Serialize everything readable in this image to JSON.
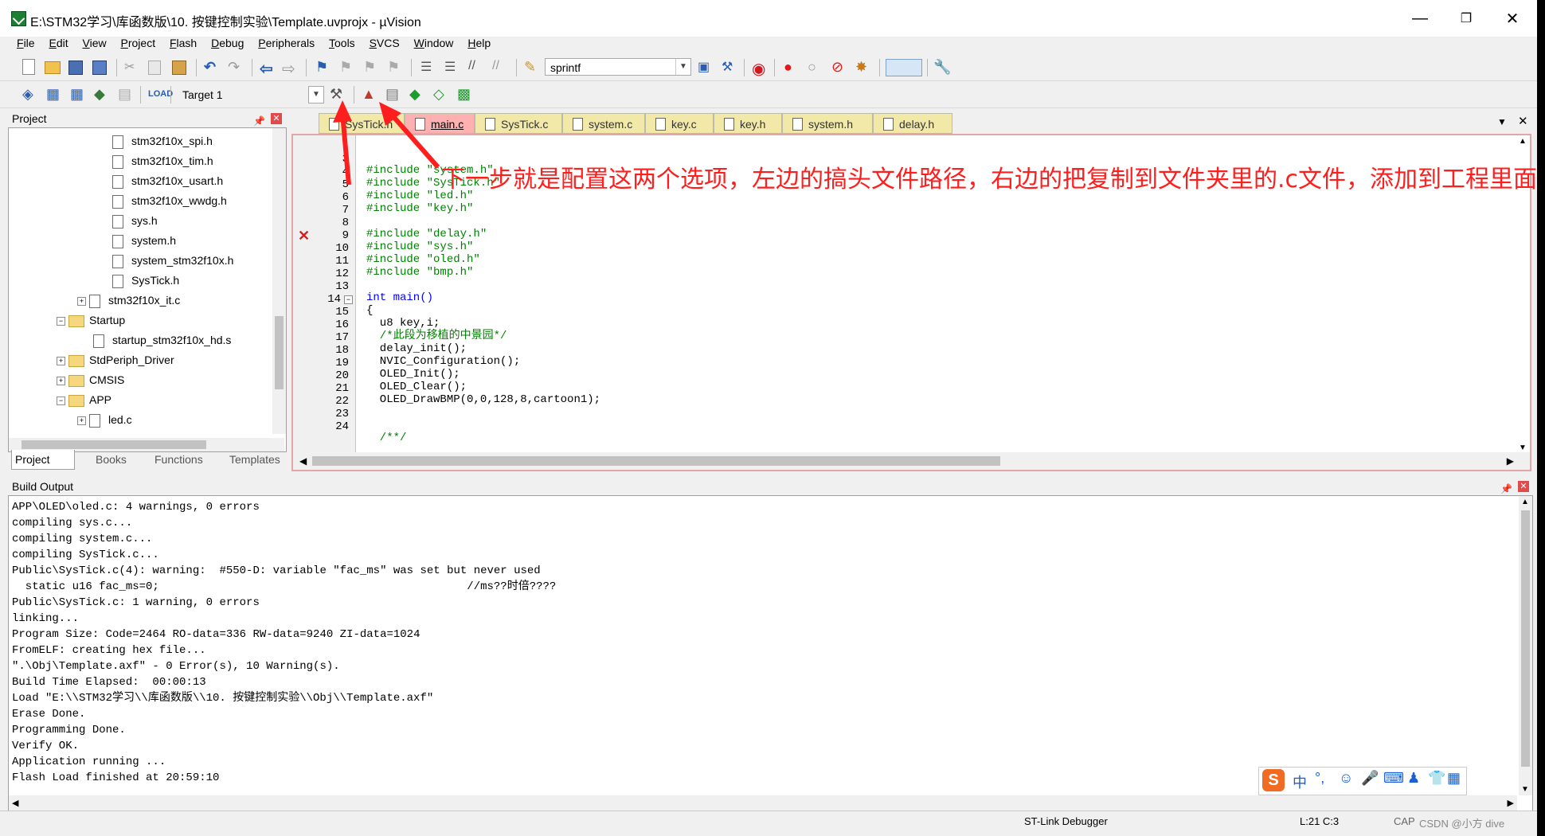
{
  "window": {
    "title": "E:\\STM32学习\\库函数版\\10. 按键控制实验\\Template.uvprojx - µVision",
    "min": "—",
    "max": "❐",
    "close": "✕"
  },
  "menu": [
    "File",
    "Edit",
    "View",
    "Project",
    "Flash",
    "Debug",
    "Peripherals",
    "Tools",
    "SVCS",
    "Window",
    "Help"
  ],
  "toolbar": {
    "find_text": "sprintf",
    "target": "Target 1"
  },
  "project_panel": {
    "title": "Project",
    "items": [
      {
        "label": "stm32f10x_spi.h"
      },
      {
        "label": "stm32f10x_tim.h"
      },
      {
        "label": "stm32f10x_usart.h"
      },
      {
        "label": "stm32f10x_wwdg.h"
      },
      {
        "label": "sys.h"
      },
      {
        "label": "system.h"
      },
      {
        "label": "system_stm32f10x.h"
      },
      {
        "label": "SysTick.h"
      },
      {
        "label": "stm32f10x_it.c"
      },
      {
        "label": "Startup"
      },
      {
        "label": "startup_stm32f10x_hd.s"
      },
      {
        "label": "StdPeriph_Driver"
      },
      {
        "label": "CMSIS"
      },
      {
        "label": "APP"
      },
      {
        "label": "led.c"
      }
    ],
    "tabs": [
      "Project",
      "Books",
      "Functions",
      "Templates"
    ]
  },
  "editor": {
    "tabs": [
      "SysTick.h",
      "main.c",
      "SysTick.c",
      "system.c",
      "key.c",
      "key.h",
      "system.h",
      "delay.h"
    ],
    "active_tab": "main.c",
    "line_numbers": [
      "3",
      "4",
      "5",
      "6",
      "7",
      "8",
      "9",
      "10",
      "11",
      "12",
      "13",
      "14",
      "15",
      "16",
      "17",
      "18",
      "19",
      "20",
      "21",
      "22",
      "23",
      "24"
    ],
    "lines": [
      "#include \"system.h\"",
      "#include \"SysTick.h\"",
      "#include \"led.h\"",
      "#include \"key.h\"",
      "",
      "#include \"delay.h\"",
      "#include \"sys.h\"",
      "#include \"oled.h\"",
      "#include \"bmp.h\"",
      "",
      "int main()",
      "{",
      "  u8 key,i;",
      "  /*此段为移植的中景园*/",
      "  delay_init();",
      "  NVIC_Configuration();",
      "  OLED_Init();",
      "  OLED_Clear();",
      "  OLED_DrawBMP(0,0,128,8,cartoon1);",
      "",
      "",
      "  /**/"
    ],
    "annotation": "下一步就是配置这两个选项，左边的搞头文件路径，右边的把复制到文件夹里的.c文件，添加到工程里面"
  },
  "build_output": {
    "title": "Build Output",
    "lines": [
      "APP\\OLED\\oled.c: 4 warnings, 0 errors",
      "compiling sys.c...",
      "compiling system.c...",
      "compiling SysTick.c...",
      "Public\\SysTick.c(4): warning:  #550-D: variable \"fac_ms\" was set but never used",
      "  static u16 fac_ms=0;                                              //ms??时倍????",
      "Public\\SysTick.c: 1 warning, 0 errors",
      "linking...",
      "Program Size: Code=2464 RO-data=336 RW-data=9240 ZI-data=1024",
      "FromELF: creating hex file...",
      "\".\\Obj\\Template.axf\" - 0 Error(s), 10 Warning(s).",
      "Build Time Elapsed:  00:00:13",
      "Load \"E:\\\\STM32学习\\\\库函数版\\\\10. 按键控制实验\\\\Obj\\\\Template.axf\"",
      "Erase Done.",
      "Programming Done.",
      "Verify OK.",
      "Application running ...",
      "Flash Load finished at 20:59:10"
    ]
  },
  "status": {
    "debugger": "ST-Link Debugger",
    "cursor": "L:21 C:3",
    "caps": "CAP",
    "watermark": "CSDN @小方 dive"
  },
  "ime": {
    "label": "中"
  }
}
